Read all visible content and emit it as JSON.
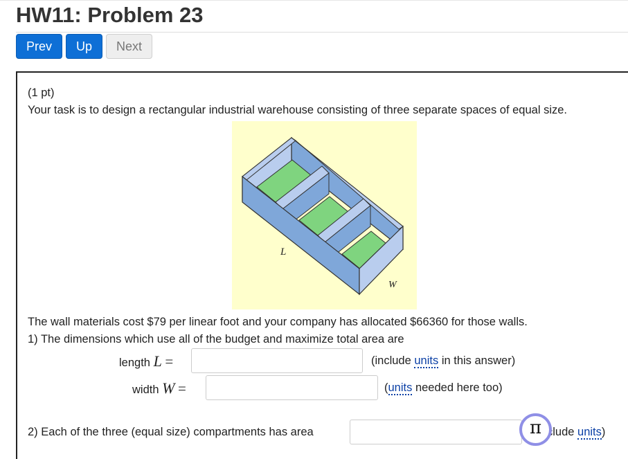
{
  "page": {
    "title": "HW11: Problem 23"
  },
  "nav": {
    "prev_label": "Prev",
    "up_label": "Up",
    "next_label": "Next"
  },
  "problem": {
    "points": "(1 pt)",
    "task": "Your task is to design a rectangular industrial warehouse consisting of three separate spaces of equal size.",
    "figure": {
      "length_label": "L",
      "width_label": "W",
      "colors": {
        "background": "#ffffcc",
        "walls_dark": "#7fa7d9",
        "walls_light": "#b9cdee",
        "floor": "#7fd47f",
        "outline": "#333333"
      }
    },
    "cost_text": "The wall materials cost $79 per linear foot and your company has allocated $66360 for those walls.",
    "q1_text": "1) The dimensions which use all of the budget and maximize total area are",
    "length_label": "length",
    "length_var": "L",
    "equals": "=",
    "length_value": "",
    "length_hint_pre": "(include ",
    "units_link": "units",
    "length_hint_post": " in this answer)",
    "width_label": "width",
    "width_var": "W",
    "width_value": "",
    "width_hint_pre": "(",
    "width_hint_post": " needed here too)",
    "q2_text": "2) Each of the three (equal size) compartments has area",
    "area_value": "",
    "area_hint_pre": "clude ",
    "area_hint_post": ")",
    "pi_symbol": "π"
  }
}
